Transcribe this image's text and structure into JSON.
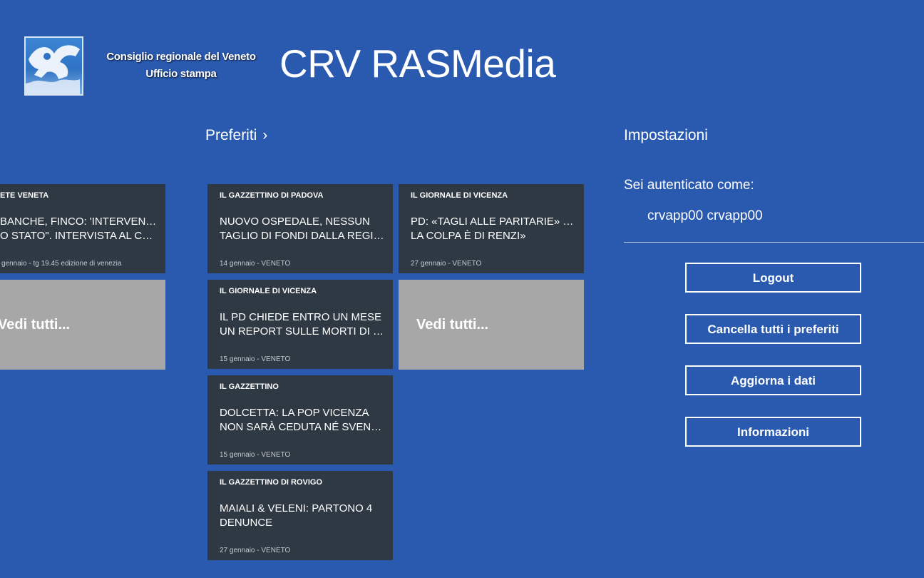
{
  "header": {
    "org_line1": "Consiglio regionale del Veneto",
    "org_line2": "Ufficio stampa",
    "app_title": "CRV RASMedia"
  },
  "sections": {
    "preferiti": "Preferiti",
    "chevron": "›",
    "impostazioni": "Impostazioni"
  },
  "left_column": {
    "tile": {
      "source": "ETE VENETA",
      "line1": "BANCHE, FINCO: 'INTERVENGA",
      "line2": "O STATO\". INTERVISTA AL CO…",
      "meta": "gennaio - tg 19.45 edizione di venezia"
    },
    "see_all": "Vedi tutti..."
  },
  "favorites": [
    {
      "source": "IL GAZZETTINO DI PADOVA",
      "line1": "NUOVO OSPEDALE, NESSUN",
      "line2": "TAGLIO DI FONDI DALLA REGI…",
      "meta": "14 gennaio - VENETO"
    },
    {
      "source": "IL GIORNALE DI VICENZA",
      "line1": "IL PD CHIEDE ENTRO UN MESE",
      "line2": "UN REPORT SULLE MORTI DI P…",
      "meta": "15 gennaio - VENETO"
    },
    {
      "source": "IL GAZZETTINO",
      "line1": "DOLCETTA: LA POP VICENZA",
      "line2": "NON SARÀ CEDUTA NÉ SVEND…",
      "meta": "15 gennaio - VENETO"
    },
    {
      "source": "IL GAZZETTINO DI ROVIGO",
      "line1": "MAIALI & VELENI: PARTONO 4",
      "line2": "DENUNCE",
      "meta": "27 gennaio - VENETO"
    },
    {
      "source": "IL GIORNALE DI VICENZA",
      "line1": "PD: «TAGLI ALLE PARITARIE» «MA",
      "line2": "LA COLPA È DI RENZI»",
      "meta": "27 gennaio - VENETO"
    }
  ],
  "favorites_see_all": "Vedi tutti...",
  "settings": {
    "auth_label": "Sei autenticato come:",
    "user": "crvapp00 crvapp00",
    "buttons": {
      "logout": "Logout",
      "clear_favorites": "Cancella tutti i preferiti",
      "refresh": "Aggiorna i dati",
      "info": "Informazioni"
    }
  },
  "colors": {
    "background": "#2a5ab0",
    "tile": "#2e3943",
    "see_all_tile": "#a7a7a7"
  }
}
